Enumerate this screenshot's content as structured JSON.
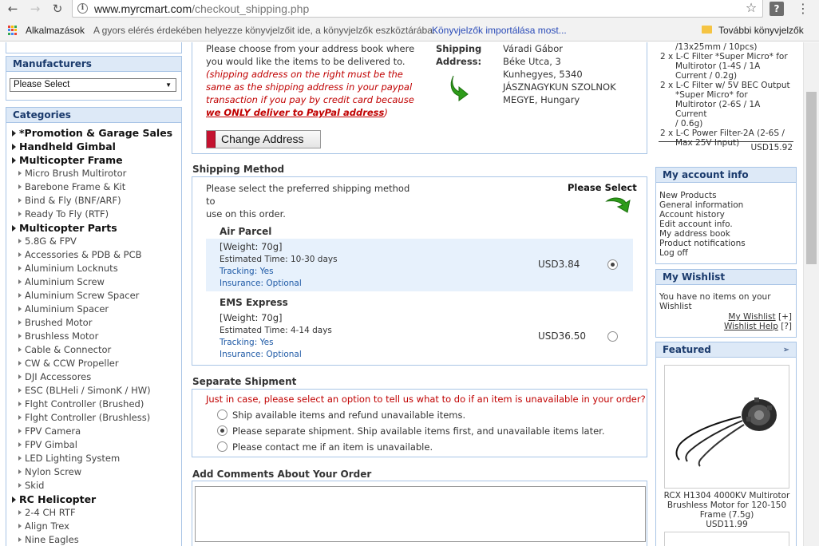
{
  "browser": {
    "url_domain": "www.myrcmart.com",
    "url_path": "/checkout_shipping.php",
    "bookmarks": {
      "apps_label": "Alkalmazások",
      "hint": "A gyors elérés érdekében helyezze könyvjelzőit ide, a könyvjelzők eszköztárába.",
      "import_link": "Könyvjelzők importálása most...",
      "more_label": "További könyvjelzők"
    }
  },
  "sidebar": {
    "manufacturers": {
      "title": "Manufacturers",
      "select_value": "Please Select"
    },
    "categories": {
      "title": "Categories",
      "items": [
        {
          "label": "*Promotion & Garage Sales",
          "level": "main"
        },
        {
          "label": "Handheld Gimbal",
          "level": "main"
        },
        {
          "label": "Multicopter Frame",
          "level": "main"
        },
        {
          "label": "Micro Brush Multirotor",
          "level": "sub"
        },
        {
          "label": "Barebone Frame & Kit",
          "level": "sub"
        },
        {
          "label": "Bind & Fly (BNF/ARF)",
          "level": "sub"
        },
        {
          "label": "Ready To Fly (RTF)",
          "level": "sub"
        },
        {
          "label": "Multicopter Parts",
          "level": "main"
        },
        {
          "label": "5.8G & FPV",
          "level": "sub"
        },
        {
          "label": "Accessories & PDB & PCB",
          "level": "sub"
        },
        {
          "label": "Aluminium Locknuts",
          "level": "sub"
        },
        {
          "label": "Aluminium Screw",
          "level": "sub"
        },
        {
          "label": "Aluminium Screw Spacer",
          "level": "sub"
        },
        {
          "label": "Aluminium Spacer",
          "level": "sub"
        },
        {
          "label": "Brushed Motor",
          "level": "sub"
        },
        {
          "label": "Brushless Motor",
          "level": "sub"
        },
        {
          "label": "Cable & Connector",
          "level": "sub"
        },
        {
          "label": "CW & CCW Propeller",
          "level": "sub"
        },
        {
          "label": "DJI Accessores",
          "level": "sub"
        },
        {
          "label": "ESC (BLHeli / SimonK / HW)",
          "level": "sub"
        },
        {
          "label": "Flght Controller (Brushed)",
          "level": "sub"
        },
        {
          "label": "Flght Controller (Brushless)",
          "level": "sub"
        },
        {
          "label": "FPV Camera",
          "level": "sub"
        },
        {
          "label": "FPV Gimbal",
          "level": "sub"
        },
        {
          "label": "LED Lighting System",
          "level": "sub"
        },
        {
          "label": "Nylon Screw",
          "level": "sub"
        },
        {
          "label": "Skid",
          "level": "sub"
        },
        {
          "label": "RC Helicopter",
          "level": "main"
        },
        {
          "label": "2-4 CH RTF",
          "level": "sub"
        },
        {
          "label": "Align Trex",
          "level": "sub"
        },
        {
          "label": "Nine Eagles",
          "level": "sub"
        }
      ]
    }
  },
  "address": {
    "intro_1": "Please choose from your address book where",
    "intro_2": "you would like the items to be delivered to.",
    "warning_1": "(shipping address on the right must be the",
    "warning_2": "same as the shipping address in your paypal",
    "warning_3": "transaction if you pay by credit card because",
    "warning_bold": "we ONLY deliver to PayPal address",
    "warning_end": ")",
    "shipping_label_1": "Shipping",
    "shipping_label_2": "Address:",
    "lines": [
      "Váradi Gábor",
      "Béke Utca, 3",
      "Kunhegyes, 5340",
      "JÁSZNAGYKUN SZOLNOK",
      "MEGYE, Hungary"
    ],
    "change_button": "Change Address"
  },
  "shipping_method": {
    "title": "Shipping Method",
    "desc_1": "Please select the preferred shipping method to",
    "desc_2": "use on this order.",
    "please_select": "Please Select",
    "options": [
      {
        "name": "Air Parcel",
        "weight": "[Weight: 70g]",
        "time": "Estimated Time: 10-30 days",
        "tracking": "Tracking: Yes",
        "insurance": "Insurance: Optional",
        "price": "USD3.84",
        "selected": true
      },
      {
        "name": "EMS Express",
        "weight": "[Weight: 70g]",
        "time": "Estimated Time: 4-14 days",
        "tracking": "Tracking: Yes",
        "insurance": "Insurance: Optional",
        "price": "USD36.50",
        "selected": false
      }
    ]
  },
  "separate_shipment": {
    "title": "Separate Shipment",
    "warning": "Just in case, please select an option to tell us what to do if an item is unavailable in your order?",
    "options": [
      {
        "label": "Ship available items and refund unavailable items.",
        "selected": false
      },
      {
        "label": "Please separate shipment. Ship available items first, and unavailable items later.",
        "selected": true
      },
      {
        "label": "Please contact me if an item is unavailable.",
        "selected": false
      }
    ]
  },
  "comments": {
    "title": "Add Comments About Your Order",
    "value": ""
  },
  "cart": {
    "lines": [
      "/13x25mm / 10pcs)",
      "2 x L-C Filter *Super Micro* for",
      "Multirotor (1-4S / 1A",
      "Current / 0.2g)",
      "2 x L-C Filter w/ 5V BEC Output",
      "*Super Micro* for",
      "Multirotor (2-6S / 1A Current",
      "/ 0.6g)",
      "2 x L-C Power Filter-2A (2-6S /",
      "Max 25V Input)"
    ],
    "total": "USD15.92"
  },
  "account": {
    "title": "My account info",
    "links": [
      "New Products",
      "General information",
      "Account history",
      "Edit account info.",
      "My address book",
      "Product notifications",
      "Log off"
    ]
  },
  "wishlist": {
    "title": "My Wishlist",
    "empty_1": "You have no items on your",
    "empty_2": "Wishlist",
    "link_wishlist": "My Wishlist",
    "link_wishlist_suffix": "[+]",
    "link_help": "Wishlist Help",
    "link_help_suffix": "[?]"
  },
  "featured": {
    "title": "Featured",
    "product_name_1": "RCX H1304 4000KV Multirotor",
    "product_name_2": "Brushless Motor for 120-150",
    "product_name_3": "Frame (7.5g)",
    "product_price": "USD11.99"
  },
  "colors": {
    "box_border": "#a9c5e6",
    "box_header_bg": "#dde9f7",
    "warning_red": "#c00000",
    "selected_row_bg": "#e7f1fc",
    "arrow_green": "#2e9c1a"
  }
}
